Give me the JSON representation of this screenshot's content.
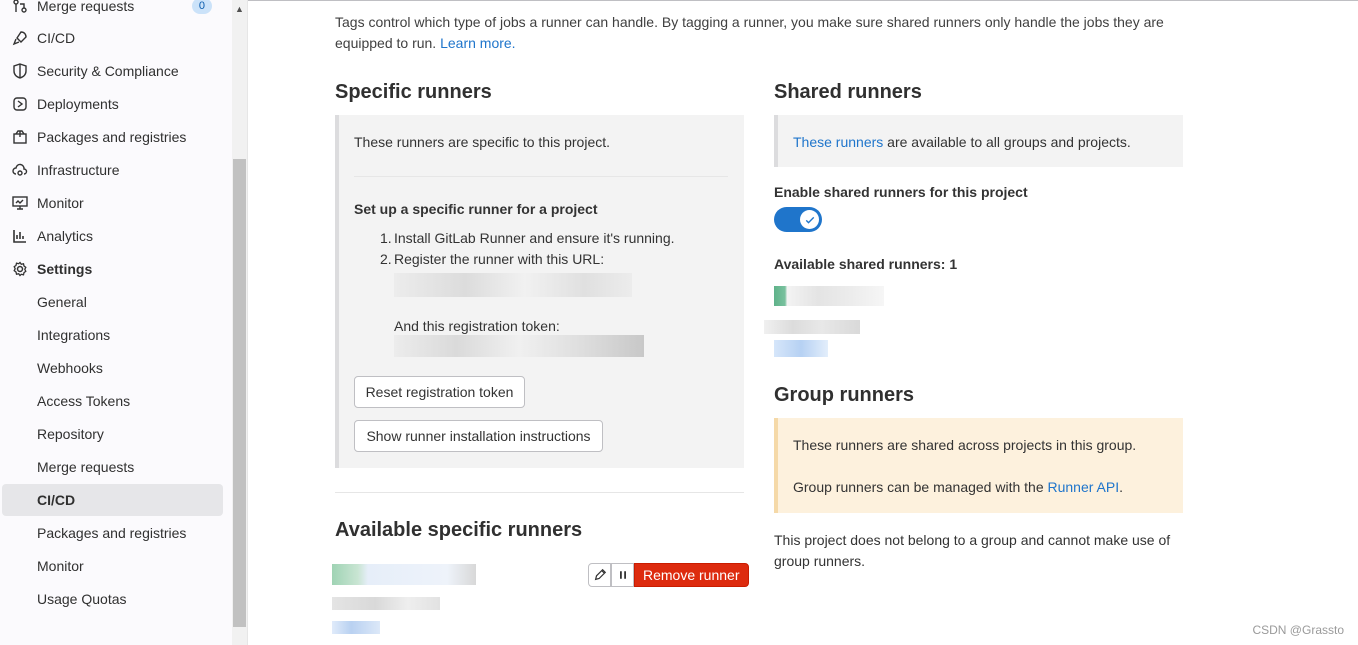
{
  "sidebar": {
    "merge_requests": {
      "label": "Merge requests",
      "count": "0"
    },
    "items": [
      {
        "label": "CI/CD",
        "icon": "rocket-icon"
      },
      {
        "label": "Security & Compliance",
        "icon": "shield-icon"
      },
      {
        "label": "Deployments",
        "icon": "deployments-icon"
      },
      {
        "label": "Packages and registries",
        "icon": "package-icon"
      },
      {
        "label": "Infrastructure",
        "icon": "cloud-gear-icon"
      },
      {
        "label": "Monitor",
        "icon": "monitor-icon"
      },
      {
        "label": "Analytics",
        "icon": "chart-icon"
      },
      {
        "label": "Settings",
        "icon": "settings-icon"
      }
    ],
    "settings_sub": [
      "General",
      "Integrations",
      "Webhooks",
      "Access Tokens",
      "Repository",
      "Merge requests",
      "CI/CD",
      "Packages and registries",
      "Monitor",
      "Usage Quotas"
    ]
  },
  "intro": {
    "text": "Tags control which type of jobs a runner can handle. By tagging a runner, you make sure shared runners only handle the jobs they are equipped to run.",
    "link": "Learn more."
  },
  "specific": {
    "title": "Specific runners",
    "desc": "These runners are specific to this project.",
    "setup_title": "Set up a specific runner for a project",
    "step1_num": "1.",
    "step1_link": "Install GitLab Runner and ensure it's running.",
    "step2_num": "2.",
    "step2_text": "Register the runner with this URL:",
    "token_text": "And this registration token:",
    "reset_button": "Reset registration token",
    "show_button": "Show runner installation instructions"
  },
  "available_specific": {
    "title": "Available specific runners",
    "remove_button": "Remove runner",
    "edit_icon": "pencil-icon",
    "pause_icon": "pause-icon"
  },
  "shared": {
    "title": "Shared runners",
    "desc_link": "These runners",
    "desc_rest": " are available to all groups and projects.",
    "enable_label": "Enable shared runners for this project",
    "toggle_on": true,
    "available_label": "Available shared runners: 1"
  },
  "group": {
    "title": "Group runners",
    "desc1": "These runners are shared across projects in this group.",
    "desc2_pre": "Group runners can be managed with the ",
    "desc2_link": "Runner API",
    "desc2_post": ".",
    "note": "This project does not belong to a group and cannot make use of group runners."
  },
  "watermark": "CSDN @Grassto",
  "colors": {
    "link": "#1f75cb",
    "danger": "#dd2b0e",
    "toggle": "#1f75cb",
    "warning_bg": "#fdf1dd"
  }
}
